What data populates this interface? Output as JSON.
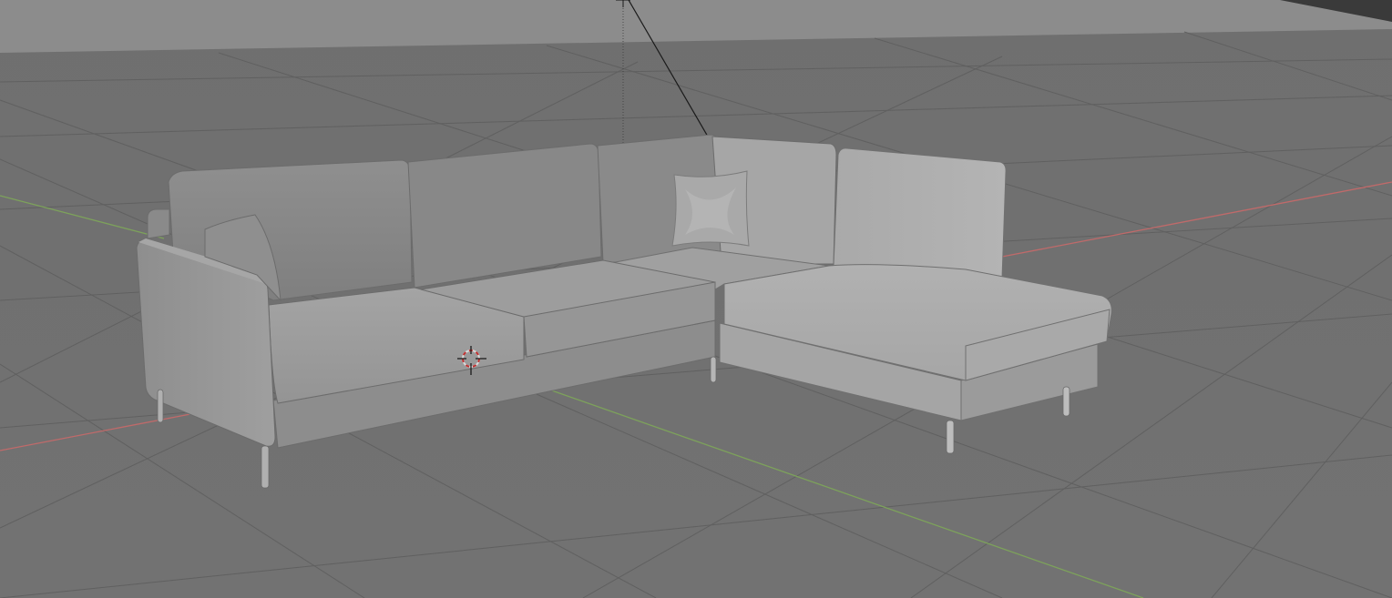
{
  "viewport": {
    "background_top": "#6f6f6f",
    "background_bottom": "#717171",
    "world_backdrop": "#8c8c8c",
    "corner_panel": "#3a3a3a"
  },
  "grid": {
    "line_color": "#5f5f5f",
    "x_axis_color": "#c06a6a",
    "y_axis_color": "#7da25b"
  },
  "model": {
    "name": "sectional sofa",
    "shade_light": "#b3b3b3",
    "shade_mid": "#9b9b9b",
    "shade_dark": "#858585",
    "outline": "#6a6a6a"
  },
  "icons": {
    "cursor": "3d-cursor-icon",
    "light_origin": "light-origin-icon"
  }
}
